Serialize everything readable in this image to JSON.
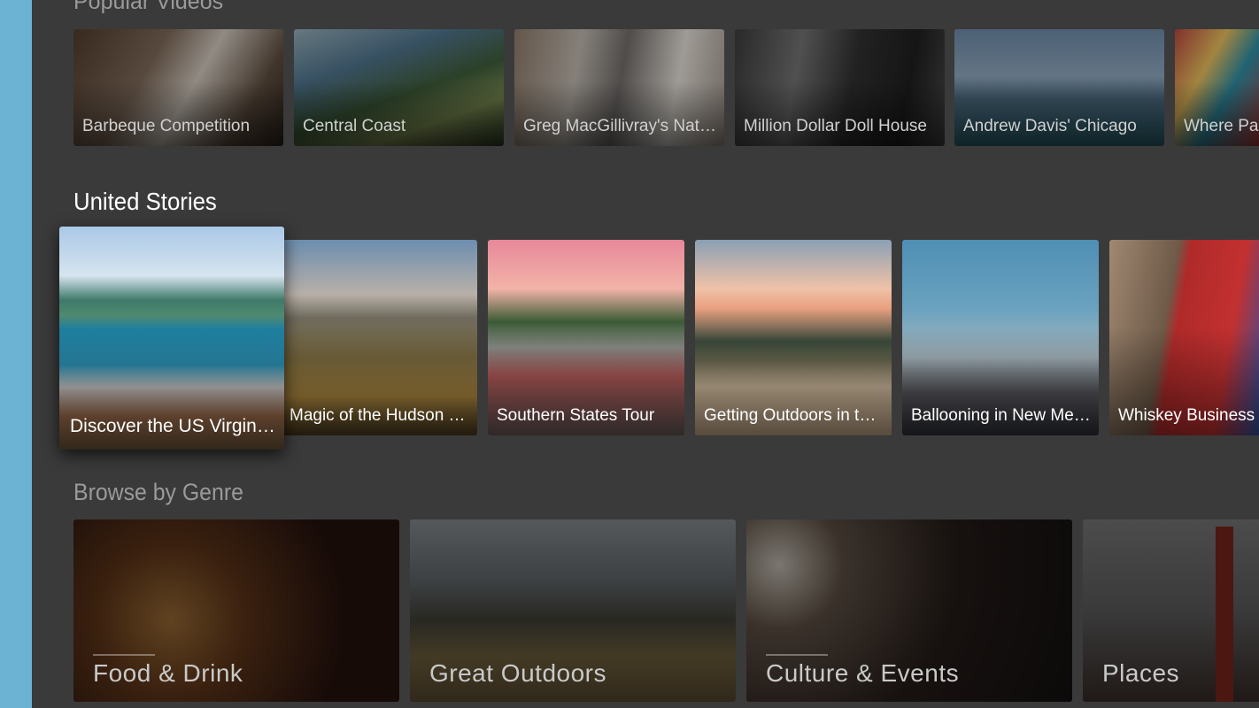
{
  "rows": {
    "popular": {
      "title": "Popular Videos",
      "items": [
        {
          "label": "Barbeque Competition"
        },
        {
          "label": "Central Coast"
        },
        {
          "label": "Greg MacGillivray's Nature Film"
        },
        {
          "label": "Million Dollar Doll House"
        },
        {
          "label": "Andrew Davis' Chicago"
        },
        {
          "label": "Where Parades Are Born"
        }
      ]
    },
    "united": {
      "title": "United Stories",
      "items": [
        {
          "label": "Discover the US Virgin Islands"
        },
        {
          "label": "Magic of the Hudson Valley"
        },
        {
          "label": "Southern States Tour"
        },
        {
          "label": "Getting Outdoors in the West"
        },
        {
          "label": "Ballooning in New Mexico"
        },
        {
          "label": "Whiskey Business"
        }
      ]
    },
    "genre": {
      "title": "Browse by Genre",
      "items": [
        {
          "label": "Food & Drink"
        },
        {
          "label": "Great Outdoors"
        },
        {
          "label": "Culture & Events"
        },
        {
          "label": "Places"
        }
      ]
    }
  },
  "colors": {
    "background": "#3a3a3a",
    "side_rail": "#6cb2d2",
    "active_title": "#ffffff",
    "inactive_title": "#9a9a9a"
  }
}
